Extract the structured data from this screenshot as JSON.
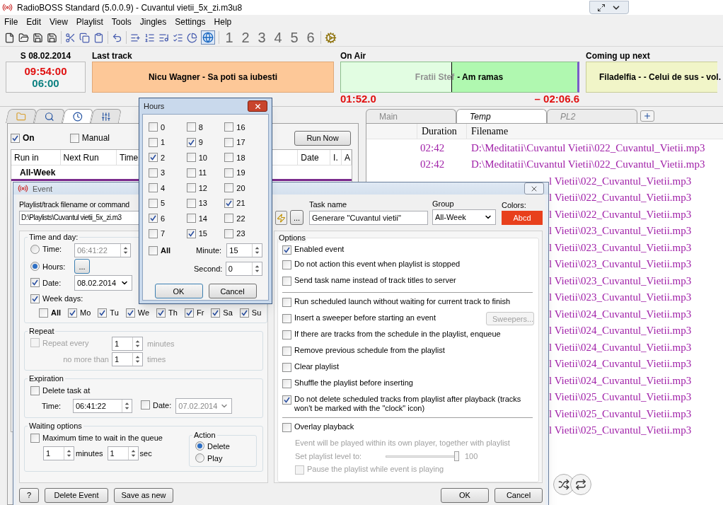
{
  "window": {
    "title": "RadioBOSS Standard (5.0.0.9) - Cuvantul vietii_5x_zi.m3u8"
  },
  "menu": [
    "File",
    "Edit",
    "View",
    "Playlist",
    "Tools",
    "Jingles",
    "Settings",
    "Help"
  ],
  "toolbar": {
    "profiles": [
      "1",
      "2",
      "3",
      "4",
      "5",
      "6"
    ]
  },
  "info_bar": {
    "date": "S 08.02.2014",
    "clock": "09:54:00",
    "countdown": "06:00",
    "last_track": {
      "label": "Last track",
      "title": "Nicu Wagner - Sa poti sa iubesti"
    },
    "on_air": {
      "label": "On Air",
      "artist": "Fratii Stef",
      "title": "- Am ramas",
      "level": 0.47,
      "elapsed": "01:52.0",
      "remaining": "– 02:06.6"
    },
    "next": {
      "label": "Coming up next",
      "title": "Filadelfia - - Celui de sus - vol."
    }
  },
  "scheduler": {
    "tabs": [
      {
        "kind": "folder",
        "selected": false
      },
      {
        "kind": "search",
        "selected": false
      },
      {
        "kind": "clock",
        "selected": true
      },
      {
        "kind": "mixer",
        "selected": false
      }
    ],
    "on": {
      "label": "On",
      "checked": true
    },
    "manual": {
      "label": "Manual",
      "checked": false
    },
    "run_now": "Run Now",
    "columns": [
      "Run in",
      "Next Run",
      "Time",
      "Date",
      "I.",
      "A"
    ],
    "group_row": "All-Week"
  },
  "playlist": {
    "tabs": [
      {
        "label": "Main",
        "selected": false
      },
      {
        "label": "Temp",
        "selected": true
      },
      {
        "label": "PL2",
        "selected": false
      }
    ],
    "columns": [
      "Duration",
      "Filename"
    ],
    "rows": [
      {
        "duration": "02:42",
        "filename": "D:\\Meditatii\\Cuvantul Vietii\\022_Cuvantul_Vietii.mp3"
      },
      {
        "duration": "02:42",
        "filename": "D:\\Meditatii\\Cuvantul Vietii\\022_Cuvantul_Vietii.mp3"
      },
      {
        "filename": "l Vietii\\022_Cuvantul_Vietii.mp3"
      },
      {
        "filename": "l Vietii\\022_Cuvantul_Vietii.mp3"
      },
      {
        "filename": "l Vietii\\022_Cuvantul_Vietii.mp3"
      },
      {
        "filename": "l Vietii\\023_Cuvantul_Vietii.mp3"
      },
      {
        "filename": "l Vietii\\023_Cuvantul_Vietii.mp3"
      },
      {
        "filename": "l Vietii\\023_Cuvantul_Vietii.mp3"
      },
      {
        "filename": "l Vietii\\023_Cuvantul_Vietii.mp3"
      },
      {
        "filename": "l Vietii\\023_Cuvantul_Vietii.mp3"
      },
      {
        "filename": "l Vietii\\024_Cuvantul_Vietii.mp3"
      },
      {
        "filename": "l Vietii\\024_Cuvantul_Vietii.mp3"
      },
      {
        "filename": "l Vietii\\024_Cuvantul_Vietii.mp3"
      },
      {
        "filename": "l Vietii\\024_Cuvantul_Vietii.mp3"
      },
      {
        "filename": "l Vietii\\024_Cuvantul_Vietii.mp3"
      },
      {
        "filename": "l Vietii\\025_Cuvantul_Vietii.mp3"
      },
      {
        "filename": "l Vietii\\025_Cuvantul_Vietii.mp3"
      },
      {
        "filename": "l Vietii\\025_Cuvantul_Vietii.mp3"
      }
    ]
  },
  "event_dialog": {
    "title": "Event",
    "command": {
      "label": "Playlist/track filename or command",
      "value": "D:\\Playlists\\Cuvantul vietii_5x_zi.m3"
    },
    "browse": "...",
    "task_name": {
      "label": "Task name",
      "value": "Generare \"Cuvantul vietii\""
    },
    "group": {
      "label": "Group",
      "value": "All-Week"
    },
    "colors": {
      "label": "Colors:",
      "sample": "Abcd"
    },
    "time_and_day": {
      "title": "Time and day:",
      "time": {
        "label": "Time:",
        "selected": false,
        "value": "06:41:22"
      },
      "hours": {
        "label": "Hours:",
        "selected": true,
        "button": "..."
      },
      "date": {
        "label": "Date:",
        "checked": true,
        "value": "08.02.2014"
      },
      "week_days": {
        "label": "Week days:",
        "checked": true
      },
      "days": [
        {
          "label": "All",
          "checked": false
        },
        {
          "label": "Mo",
          "checked": true
        },
        {
          "label": "Tu",
          "checked": true
        },
        {
          "label": "We",
          "checked": true
        },
        {
          "label": "Th",
          "checked": true
        },
        {
          "label": "Fr",
          "checked": true
        },
        {
          "label": "Sa",
          "checked": true
        },
        {
          "label": "Su",
          "checked": true
        }
      ]
    },
    "repeat": {
      "title": "Repeat",
      "repeat_every": {
        "label": "Repeat every",
        "checked": false,
        "disabled": true,
        "value": "1",
        "unit": "minutes"
      },
      "no_more_than": {
        "label": "no more than",
        "value": "1",
        "unit": "times"
      }
    },
    "expiration": {
      "title": "Expiration",
      "delete_task": {
        "label": "Delete task at",
        "checked": false
      },
      "time": {
        "label": "Time:",
        "value": "06:41:22"
      },
      "date": {
        "label": "Date:",
        "checked": false,
        "value": "07.02.2014"
      }
    },
    "waiting": {
      "title": "Waiting options",
      "max_wait": {
        "label": "Maximum time to wait in the queue",
        "checked": false
      },
      "minutes": {
        "value": "1",
        "unit": "minutes"
      },
      "seconds": {
        "value": "1",
        "unit": "sec"
      },
      "action": {
        "title": "Action",
        "options": [
          {
            "label": "Delete",
            "selected": true
          },
          {
            "label": "Play",
            "selected": false
          }
        ]
      }
    },
    "options": {
      "title": "Options",
      "items": [
        {
          "kind": "checkbox",
          "label": "Enabled event",
          "checked": true
        },
        {
          "kind": "checkbox",
          "label": "Do not action this event when playlist is stopped",
          "checked": false
        },
        {
          "kind": "checkbox",
          "label": "Send task name instead of track titles to server",
          "checked": false
        },
        {
          "kind": "separator"
        },
        {
          "kind": "checkbox",
          "label": "Run scheduled launch without waiting for current track to finish",
          "checked": false
        },
        {
          "kind": "checkbox",
          "label": "Insert a sweeper before starting an event",
          "checked": false,
          "button": {
            "label": "Sweepers...",
            "disabled": true
          }
        },
        {
          "kind": "checkbox",
          "label": "If there are tracks from the schedule in the playlist, enqueue",
          "checked": false
        },
        {
          "kind": "checkbox",
          "label": "Remove previous schedule from the playlist",
          "checked": false
        },
        {
          "kind": "checkbox",
          "label": "Clear playlist",
          "checked": false
        },
        {
          "kind": "checkbox",
          "label": "Shuffle the playlist before inserting",
          "checked": false
        },
        {
          "kind": "checkbox",
          "label": "Do not delete scheduled tracks from playlist after playback (tracks won't be marked with the \"clock\" icon)",
          "checked": true
        },
        {
          "kind": "separator"
        },
        {
          "kind": "checkbox",
          "label": "Overlay playback",
          "checked": false,
          "children": [
            {
              "kind": "note",
              "label": "Event will be played within its own player, together with playlist",
              "disabled": true
            },
            {
              "kind": "slider",
              "label": "Set playlist level to:",
              "level": 1,
              "reading": "100",
              "disabled": true
            },
            {
              "kind": "checkbox",
              "label": "Pause the playlist while event is playing",
              "checked": false,
              "disabled": true
            }
          ]
        }
      ]
    },
    "footer_left": [
      "?",
      "Delete Event",
      "Save as new"
    ],
    "footer_right": [
      "OK",
      "Cancel"
    ]
  },
  "hours_dialog": {
    "title": "Hours",
    "hours": [
      {
        "label": "0",
        "checked": false
      },
      {
        "label": "1",
        "checked": false
      },
      {
        "label": "2",
        "checked": true
      },
      {
        "label": "3",
        "checked": false
      },
      {
        "label": "4",
        "checked": false
      },
      {
        "label": "5",
        "checked": false
      },
      {
        "label": "6",
        "checked": true
      },
      {
        "label": "7",
        "checked": false
      },
      {
        "label": "8",
        "checked": false
      },
      {
        "label": "9",
        "checked": true
      },
      {
        "label": "10",
        "checked": false
      },
      {
        "label": "11",
        "checked": false
      },
      {
        "label": "12",
        "checked": false
      },
      {
        "label": "13",
        "checked": false
      },
      {
        "label": "14",
        "checked": false
      },
      {
        "label": "15",
        "checked": true
      },
      {
        "label": "16",
        "checked": false
      },
      {
        "label": "17",
        "checked": false
      },
      {
        "label": "18",
        "checked": false
      },
      {
        "label": "19",
        "checked": false
      },
      {
        "label": "20",
        "checked": false
      },
      {
        "label": "21",
        "checked": true
      },
      {
        "label": "22",
        "checked": false
      },
      {
        "label": "23",
        "checked": false
      }
    ],
    "all": {
      "label": "All",
      "checked": false
    },
    "minute": {
      "label": "Minute:",
      "value": "15"
    },
    "second": {
      "label": "Second:",
      "value": "0"
    },
    "buttons": [
      "OK",
      "Cancel"
    ]
  }
}
